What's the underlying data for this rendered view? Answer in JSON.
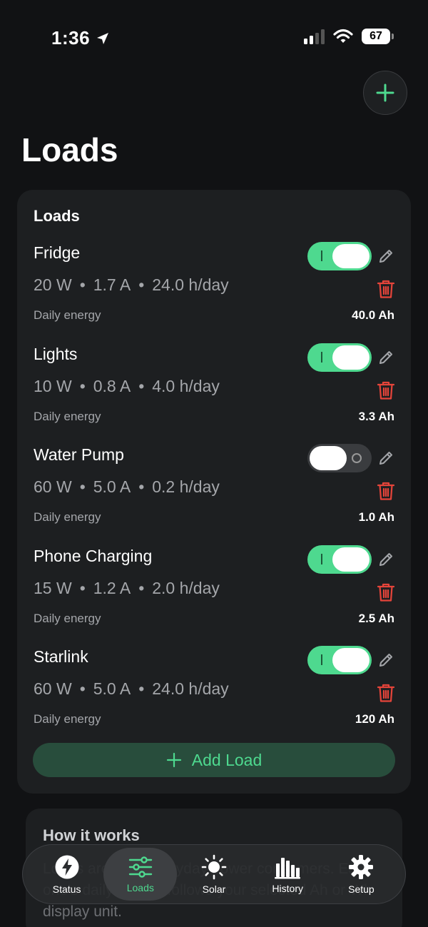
{
  "status_bar": {
    "time": "1:36",
    "battery": "67"
  },
  "colors": {
    "accent": "#4ed98f",
    "danger": "#e5443a",
    "background": "#111214",
    "card": "#1d1f21"
  },
  "page": {
    "title": "Loads"
  },
  "loads_card": {
    "title": "Loads",
    "daily_label": "Daily energy",
    "add_load_label": "Add Load",
    "items": [
      {
        "name": "Fridge",
        "watts": "20 W",
        "amps": "1.7 A",
        "hours": "24.0 h/day",
        "energy": "40.0 Ah",
        "enabled": true
      },
      {
        "name": "Lights",
        "watts": "10 W",
        "amps": "0.8 A",
        "hours": "4.0 h/day",
        "energy": "3.3 Ah",
        "enabled": true
      },
      {
        "name": "Water Pump",
        "watts": "60 W",
        "amps": "5.0 A",
        "hours": "0.2 h/day",
        "energy": "1.0 Ah",
        "enabled": false
      },
      {
        "name": "Phone Charging",
        "watts": "15 W",
        "amps": "1.2 A",
        "hours": "2.0 h/day",
        "energy": "2.5 Ah",
        "enabled": true
      },
      {
        "name": "Starlink",
        "watts": "60 W",
        "amps": "5.0 A",
        "hours": "24.0 h/day",
        "energy": "120 Ah",
        "enabled": true
      }
    ]
  },
  "how_it_works": {
    "title": "How it works",
    "body": "Loads are your everyday power consumers. Each one's daily energy follows your selected Ah or Wh display unit."
  },
  "tab_bar": {
    "active": "loads",
    "tabs": [
      {
        "id": "status",
        "label": "Status",
        "icon": "bolt-icon"
      },
      {
        "id": "loads",
        "label": "Loads",
        "icon": "sliders-icon"
      },
      {
        "id": "solar",
        "label": "Solar",
        "icon": "sun-icon"
      },
      {
        "id": "history",
        "label": "History",
        "icon": "bar-chart-icon"
      },
      {
        "id": "setup",
        "label": "Setup",
        "icon": "gear-icon"
      }
    ]
  }
}
